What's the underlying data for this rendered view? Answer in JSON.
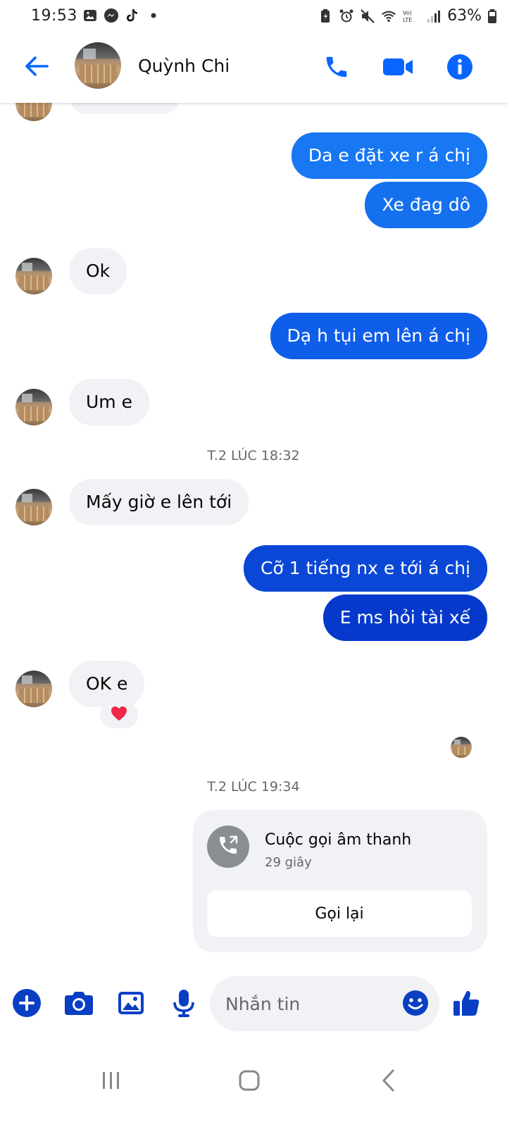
{
  "status_bar": {
    "time": "19:53",
    "battery": "63%",
    "icons": [
      "gallery-icon",
      "messenger-icon",
      "tiktok-icon",
      "dot-icon",
      "battery-saver-icon",
      "alarm-icon",
      "mute-icon",
      "wifi-icon",
      "volte-icon",
      "signal-icon",
      "battery-icon"
    ],
    "volte_label": "Vo)\nLTE"
  },
  "header": {
    "contact_name": "Quỳnh Chi",
    "icons": [
      "back-arrow-icon",
      "phone-icon",
      "video-camera-icon",
      "info-icon"
    ]
  },
  "messages": [
    {
      "id": "m1",
      "sender": "me",
      "text": "Da e đặt xe r á chị"
    },
    {
      "id": "m2",
      "sender": "me",
      "text": "Xe đag dô"
    },
    {
      "id": "m3",
      "sender": "contact",
      "text": "Ok"
    },
    {
      "id": "m4",
      "sender": "me",
      "text": "Dạ h tụi em lên á chị"
    },
    {
      "id": "m5",
      "sender": "contact",
      "text": "Um e"
    },
    {
      "id": "t1",
      "type": "timestamp",
      "text": "T.2 LÚC 18:32"
    },
    {
      "id": "m6",
      "sender": "contact",
      "text": "Mấy giờ e lên tới"
    },
    {
      "id": "m7",
      "sender": "me",
      "text": "Cỡ 1 tiếng nx e tới á chị"
    },
    {
      "id": "m8",
      "sender": "me",
      "text": "E ms hỏi tài xế"
    },
    {
      "id": "m9",
      "sender": "contact",
      "text": "OK e",
      "reaction": "❤️"
    },
    {
      "id": "t2",
      "type": "timestamp",
      "text": "T.2 LÚC 19:34"
    }
  ],
  "call_card": {
    "title": "Cuộc gọi âm thanh",
    "duration": "29 giây",
    "callback_label": "Gọi lại",
    "icon": "phone-call-icon"
  },
  "composer": {
    "placeholder": "Nhắn tin",
    "icons": [
      "plus-icon",
      "camera-icon",
      "image-icon",
      "microphone-icon",
      "emoji-icon",
      "like-icon"
    ]
  },
  "nav_bar": {
    "icons": [
      "recents-icon",
      "home-icon",
      "back-icon"
    ]
  },
  "colors": {
    "accent": "#0866ff",
    "bubble_top": "#1877f2",
    "bubble_bottom": "#0433c2",
    "incoming_bubble": "#f0f2f5",
    "composer_icon": "#0a3fc4",
    "secondary_text": "#65676b"
  }
}
